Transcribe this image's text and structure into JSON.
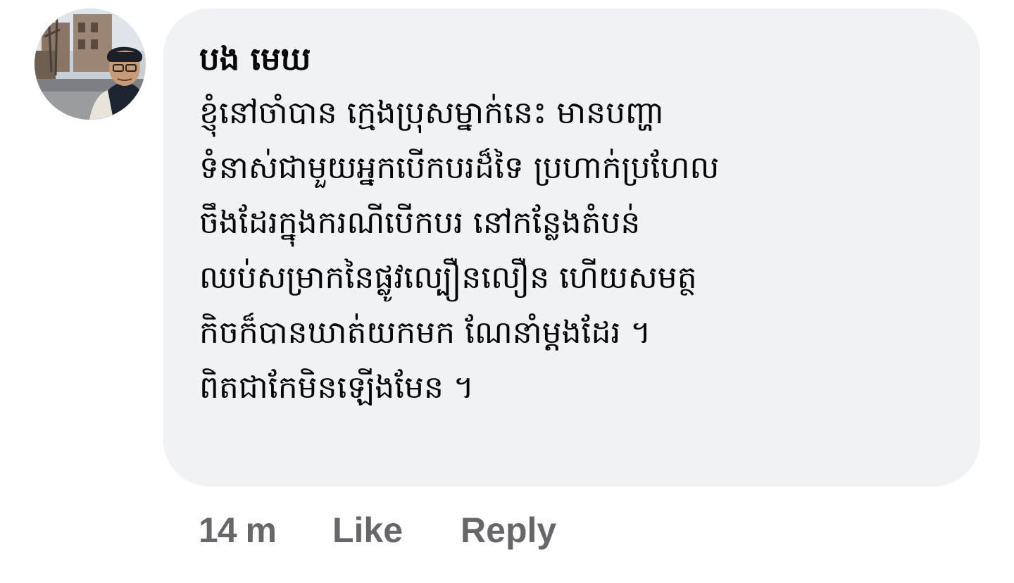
{
  "comment": {
    "author": "បង មេឃ",
    "lines": [
      "ខ្ញុំនៅចាំបាន ក្មេងប្រុសម្នាក់នេះ មានបញ្ហា",
      "ទំនាស់ជាមួយអ្នកបើកបរដ៏ទៃ ប្រហាក់ប្រហែល",
      "ចឹងដែរក្នុងករណីបើកបរ នៅកន្លែងតំបន់",
      "ឈប់សម្រាកនៃផ្លូវល្បឿនលឿន ហើយសមត្ថ",
      "កិចក៏បានឃាត់យកមក ណែនាំម្តងដែរ ។",
      "ពិតជាកែមិនឡើងមែន ។"
    ]
  },
  "actions": {
    "time": "14 m",
    "like_label": "Like",
    "reply_label": "Reply"
  },
  "colors": {
    "bubble_bg": "#f0f2f5",
    "text": "#050505",
    "secondary": "#65676b"
  }
}
